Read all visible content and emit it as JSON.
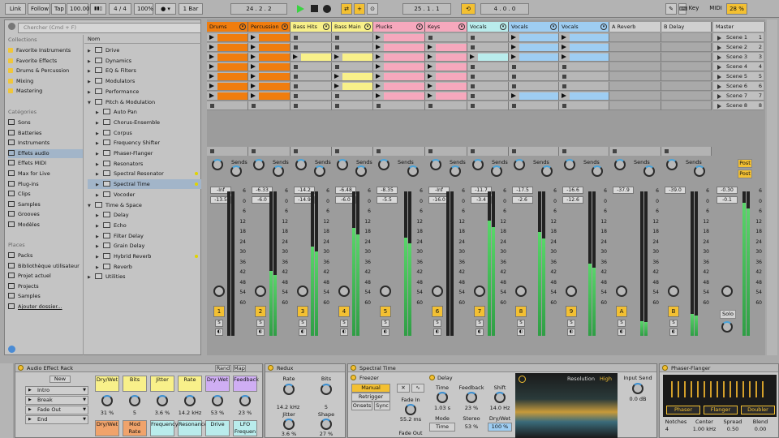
{
  "topbar": {
    "link": "Link",
    "follow": "Follow",
    "tap": "Tap",
    "tempo": "100.00",
    "sig": "4 / 4",
    "zoom": "100%",
    "quant": "1 Bar",
    "pos": "24 .   2 .   2",
    "loop_start": "25 .   1 .   1",
    "loop_len": "4 .   0 .   0",
    "key": "Key",
    "midi": "MIDI",
    "cpu": "28 %"
  },
  "browser": {
    "search_placeholder": "Chercher (Cmd + F)",
    "collections_label": "Collections",
    "collections": [
      "Favorite Instruments",
      "Favorite Effects",
      "Drums & Percussion",
      "Mixing",
      "Mastering"
    ],
    "collection_colors": [
      "#f0c63a",
      "#f0c63a",
      "#f0c63a",
      "#f0c63a",
      "#f0c63a"
    ],
    "categories_label": "Catégories",
    "categories": [
      "Sons",
      "Batteries",
      "Instruments",
      "Effets audio",
      "Effets MIDI",
      "Max for Live",
      "Plug-ins",
      "Clips",
      "Samples",
      "Grooves",
      "Modèles"
    ],
    "places_label": "Places",
    "places": [
      "Packs",
      "Bibliothèque utilisateur",
      "Projet actuel",
      "Projects",
      "Samples",
      "Ajouter dossier..."
    ],
    "column_header": "Nom",
    "files": [
      {
        "t": "Drive",
        "d": 0,
        "o": false
      },
      {
        "t": "Dynamics",
        "d": 0,
        "o": false
      },
      {
        "t": "EQ & Filters",
        "d": 0,
        "o": false
      },
      {
        "t": "Modulators",
        "d": 0,
        "o": false
      },
      {
        "t": "Performance",
        "d": 0,
        "o": false
      },
      {
        "t": "Pitch & Modulation",
        "d": 0,
        "o": true
      },
      {
        "t": "Auto Pan",
        "d": 1,
        "o": false
      },
      {
        "t": "Chorus-Ensemble",
        "d": 1,
        "o": false
      },
      {
        "t": "Corpus",
        "d": 1,
        "o": false
      },
      {
        "t": "Frequency Shifter",
        "d": 1,
        "o": false
      },
      {
        "t": "Phaser-Flanger",
        "d": 1,
        "o": false
      },
      {
        "t": "Resonators",
        "d": 1,
        "o": false
      },
      {
        "t": "Spectral Resonator",
        "d": 1,
        "o": false
      },
      {
        "t": "Spectral Time",
        "d": 1,
        "o": false
      },
      {
        "t": "Vocoder",
        "d": 1,
        "o": false
      },
      {
        "t": "Time & Space",
        "d": 0,
        "o": true
      },
      {
        "t": "Delay",
        "d": 1,
        "o": false
      },
      {
        "t": "Echo",
        "d": 1,
        "o": false
      },
      {
        "t": "Filter Delay",
        "d": 1,
        "o": false
      },
      {
        "t": "Grain Delay",
        "d": 1,
        "o": false
      },
      {
        "t": "Hybrid Reverb",
        "d": 1,
        "o": false
      },
      {
        "t": "Reverb",
        "d": 1,
        "o": false
      },
      {
        "t": "Utilities",
        "d": 0,
        "o": false
      }
    ]
  },
  "tracks": [
    {
      "name": "Drums",
      "color": "#f07d0e",
      "clips": [
        0,
        1,
        2,
        3,
        4,
        5,
        6
      ],
      "vol": "-Inf",
      "peak": "-13.5",
      "num": "1",
      "meter": 0,
      "cstrip": ""
    },
    {
      "name": "Percussion",
      "color": "#f07d0e",
      "clips": [
        0,
        1,
        2,
        3,
        4,
        5,
        6
      ],
      "vol": "-6.33",
      "peak": "-6.0",
      "num": "2",
      "meter": 0.45,
      "cstrip": "1",
      "cnum": "32"
    },
    {
      "name": "Bass Hits",
      "color": "#f8f08a",
      "clips": [
        2
      ],
      "vol": "-14.2",
      "peak": "-14.9",
      "num": "3",
      "meter": 0.62,
      "cstrip": "1",
      "cnum": "32"
    },
    {
      "name": "Bass Main",
      "color": "#f8f08a",
      "clips": [
        2,
        4,
        5
      ],
      "vol": "-6.48",
      "peak": "-6.0",
      "num": "4",
      "meter": 0.75,
      "cstrip": "1",
      "cnum": "32"
    },
    {
      "name": "Plucks",
      "color": "#f6a8bd",
      "clips": [
        0,
        1,
        2,
        3,
        4,
        5,
        6
      ],
      "vol": "-8.35",
      "peak": "-5.5",
      "num": "5",
      "meter": 0.68,
      "cstrip": "1",
      "cnum": "40"
    },
    {
      "name": "Keys",
      "color": "#f6a8bd",
      "clips": [
        1,
        2,
        3,
        4,
        5,
        6
      ],
      "vol": "-Inf",
      "peak": "-16.0",
      "num": "6",
      "meter": 0,
      "cstrip": "1",
      "cnum": "40"
    },
    {
      "name": "Vocals",
      "color": "#b9ecec",
      "clips": [
        2
      ],
      "vol": "-11.7",
      "peak": "-3.4",
      "num": "7",
      "meter": 0.8,
      "cstrip": ""
    },
    {
      "name": "Vocals",
      "color": "#9ecdf2",
      "clips": [
        0,
        1,
        2,
        6
      ],
      "vol": "-17.5",
      "peak": "-2.6",
      "num": "8",
      "meter": 0.72,
      "cstrip": "1",
      "cnum": "32"
    },
    {
      "name": "Vocals",
      "color": "#9ecdf2",
      "clips": [
        0,
        1,
        2,
        6
      ],
      "vol": "-16.6",
      "peak": "-12.6",
      "num": "9",
      "meter": 0.5,
      "cstrip": "1",
      "cnum": "32"
    },
    {
      "name": "A Reverb",
      "color": "#d0d0d0",
      "clips": [],
      "vol": "-37.9",
      "peak": "",
      "num": "A",
      "meter": 0.1,
      "cstrip": ""
    },
    {
      "name": "B Delay",
      "color": "#d0d0d0",
      "clips": [],
      "vol": "-39.0",
      "peak": "",
      "num": "B",
      "meter": 0.15,
      "cstrip": ""
    }
  ],
  "master": {
    "name": "Master",
    "vol": "-0.30",
    "peak": "-0.1",
    "scenes": [
      "Scene 1",
      "Scene 2",
      "Scene 3",
      "Scene 4",
      "Scene 5",
      "Scene 6",
      "Scene 7",
      "Scene 8"
    ],
    "scene_nums": [
      "1",
      "2",
      "3",
      "4",
      "5",
      "6",
      "7",
      "8"
    ],
    "post": "Post",
    "solo": "Solo"
  },
  "sends_label": "Sends",
  "scale": [
    "6",
    "0",
    "6",
    "12",
    "18",
    "24",
    "30",
    "36",
    "42",
    "48",
    "54",
    "60"
  ],
  "devices": {
    "rack": {
      "title": "Audio Effect Rack",
      "new": "New",
      "chains": [
        "Intro",
        "Break",
        "Fade Out",
        "End"
      ],
      "macros": [
        {
          "n": "Dry/Wet",
          "v": "31 %",
          "c": "#f8f08a"
        },
        {
          "n": "Bits",
          "v": "5",
          "c": "#f8f08a"
        },
        {
          "n": "Jitter",
          "v": "3.6 %",
          "c": "#f8f08a"
        },
        {
          "n": "Rate",
          "v": "14.2 kHz",
          "c": "#f8f08a"
        },
        {
          "n": "Dry Wet",
          "v": "53 %",
          "c": "#cfaef3"
        },
        {
          "n": "Feedback",
          "v": "23 %",
          "c": "#cfaef3"
        }
      ],
      "macros2": [
        {
          "n": "Dry/Wet",
          "c": "#f0a36b"
        },
        {
          "n": "Mod Rate",
          "c": "#f0a36b"
        },
        {
          "n": "Frequency",
          "c": "#b9ecec"
        },
        {
          "n": "Resonance",
          "c": "#b9ecec"
        },
        {
          "n": "Drive",
          "c": "#b9ecec"
        },
        {
          "n": "LFO Frequen",
          "c": "#b9ecec"
        }
      ],
      "rand": "Rand",
      "map": "Map"
    },
    "redux": {
      "title": "Redux",
      "rate_l": "Rate",
      "rate": "14.2 kHz",
      "bits_l": "Bits",
      "bits": "5",
      "jitter_l": "Jitter",
      "jitter": "3.6 %",
      "shape_l": "Shape",
      "shape": "27 %"
    },
    "spectral": {
      "title": "Spectral Time",
      "freezer": "Freezer",
      "manual": "Manual",
      "retrigger": "Retrigger",
      "onsets": "Onsets",
      "sync": "Sync",
      "fade_in_l": "Fade In",
      "fade_in": "55.2 ms",
      "fade_out_l": "Fade Out",
      "delay": "Delay",
      "time_l": "Time",
      "time": "1.03 s",
      "feedback_l": "Feedback",
      "feedback": "23 %",
      "shift_l": "Shift",
      "shift": "14.0 Hz",
      "mode_l": "Mode",
      "mode": "Time",
      "stereo_l": "Stereo",
      "stereo": "53 %",
      "drywet_l": "Dry/Wet",
      "drywet": "100 %",
      "resolution_l": "Resolution",
      "resolution": "High",
      "input_send_l": "Input Send",
      "input_send": "0.0 dB"
    },
    "phaser": {
      "title": "Phaser-Flanger",
      "modes": [
        "Phaser",
        "Flanger",
        "Doubler"
      ],
      "notches_l": "Notches",
      "notches": "4",
      "center_l": "Center",
      "center": "1.00 kHz",
      "spread_l": "Spread",
      "spread": "0.50",
      "blend_l": "Blend",
      "blend": "0.00"
    }
  }
}
